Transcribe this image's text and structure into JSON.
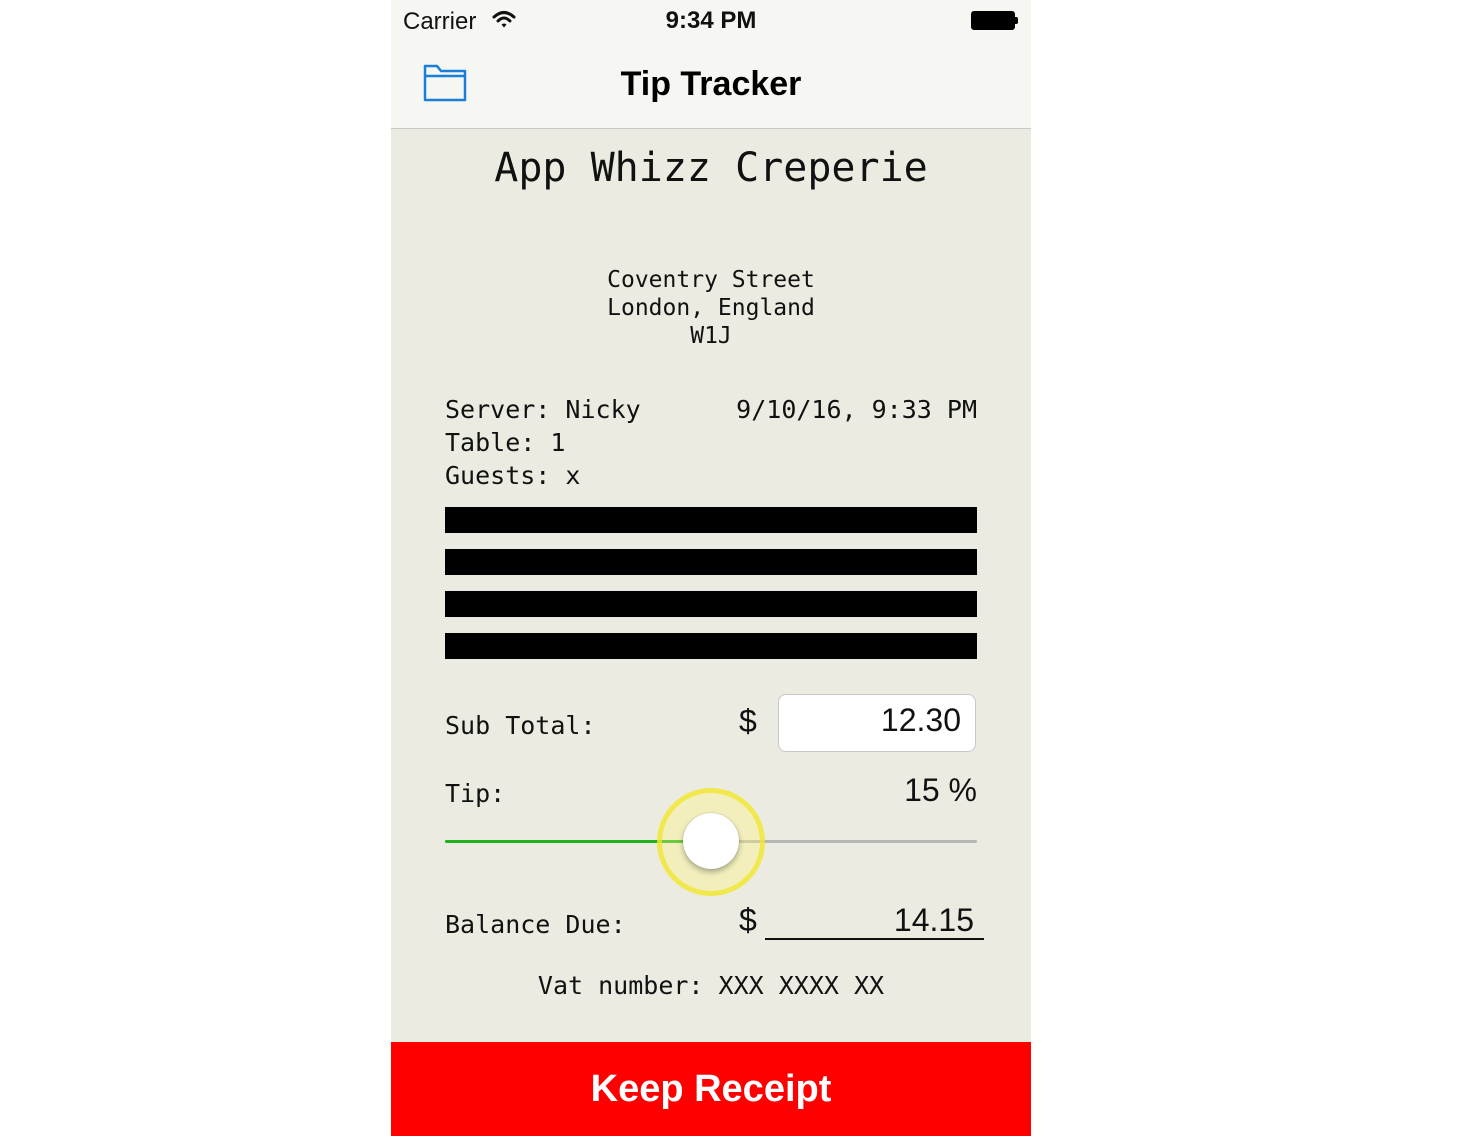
{
  "status_bar": {
    "carrier": "Carrier",
    "time": "9:34 PM",
    "wifi_icon": "wifi-icon",
    "battery_icon": "battery-icon"
  },
  "nav": {
    "title": "Tip Tracker",
    "left_icon": "folder-icon",
    "accent_color": "#1a7fd8"
  },
  "receipt": {
    "restaurant_name": "App Whizz Creperie",
    "address_line1": "Coventry Street",
    "address_line2": "London, England",
    "address_line3": "W1J",
    "server": "Server: Nicky",
    "datetime": "9/10/16, 9:33 PM",
    "table": "Table: 1",
    "guests": "Guests: x",
    "redacted_lines": 4,
    "subtotal_label": "Sub Total:",
    "currency_symbol": "$",
    "subtotal_value": "12.30",
    "tip_label": "Tip:",
    "tip_percent": "15 %",
    "tip_slider_fraction": 0.5,
    "balance_label": "Balance Due:",
    "balance_value": "14.15",
    "vat": "Vat number: XXX XXXX XX"
  },
  "actions": {
    "keep_receipt": "Keep Receipt",
    "keep_color": "#ff0000"
  }
}
